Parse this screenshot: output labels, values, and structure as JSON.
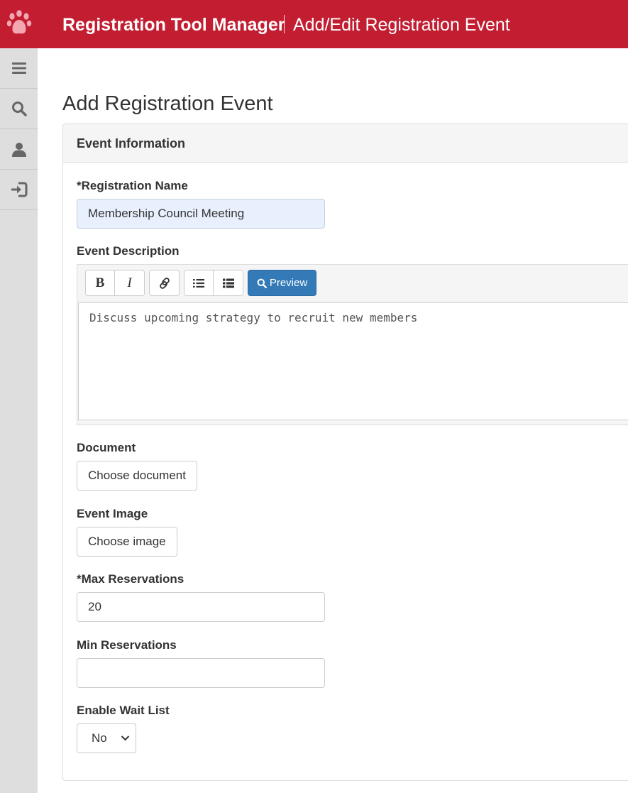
{
  "header": {
    "app_title": "Registration Tool Manager",
    "page_subtitle": "Add/Edit Registration Event",
    "logo_icon": "paw-icon",
    "brand_color": "#c21d31"
  },
  "sidebar": {
    "items": [
      {
        "icon": "menu-icon"
      },
      {
        "icon": "search-icon"
      },
      {
        "icon": "user-icon"
      },
      {
        "icon": "sign-out-icon"
      }
    ]
  },
  "main": {
    "heading": "Add Registration Event",
    "panel_title": "Event Information"
  },
  "form": {
    "registration_name": {
      "label": "*Registration Name",
      "value": "Membership Council Meeting"
    },
    "event_description": {
      "label": "Event Description",
      "toolbar": {
        "bold": "B",
        "italic": "I",
        "link_icon": "link-icon",
        "bullet_list_icon": "bulleted-list-icon",
        "numbered_list_icon": "numbered-list-icon",
        "preview_label": "Preview",
        "preview_icon": "search-icon",
        "preview_color": "#337ab7"
      },
      "value": "Discuss upcoming strategy to recruit new members"
    },
    "document": {
      "label": "Document",
      "button_label": "Choose document"
    },
    "event_image": {
      "label": "Event Image",
      "button_label": "Choose image"
    },
    "max_reservations": {
      "label": "*Max Reservations",
      "value": "20"
    },
    "min_reservations": {
      "label": "Min Reservations",
      "value": ""
    },
    "enable_wait_list": {
      "label": "Enable Wait List",
      "selected": "No"
    }
  }
}
